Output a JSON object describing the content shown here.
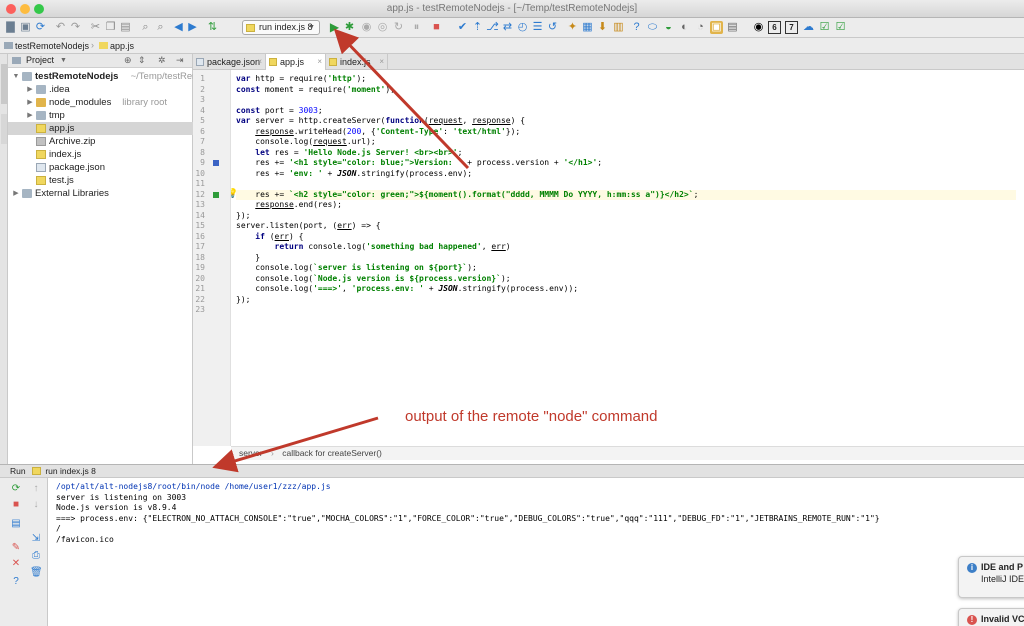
{
  "window": {
    "title": "app.js - testRemoteNodejs - [~/Temp/testRemoteNodejs]"
  },
  "toolbar": {
    "run_config": "run index.js 8",
    "right_badges": [
      "6",
      "7"
    ]
  },
  "breadcrumbs": [
    {
      "label": "testRemoteNodejs"
    },
    {
      "label": "app.js"
    }
  ],
  "project_panel": {
    "title": "Project",
    "tree": [
      {
        "label": "testRemoteNodejs",
        "hint": "~/Temp/testRem",
        "type": "root",
        "indent": 0,
        "expanded": true
      },
      {
        "label": ".idea",
        "hint": "",
        "type": "folder",
        "indent": 1,
        "expanded": false
      },
      {
        "label": "node_modules",
        "hint": "library root",
        "type": "folder-orange",
        "indent": 1,
        "expanded": false
      },
      {
        "label": "tmp",
        "hint": "",
        "type": "folder",
        "indent": 1,
        "expanded": false
      },
      {
        "label": "app.js",
        "hint": "",
        "type": "js",
        "indent": 1,
        "selected": true
      },
      {
        "label": "Archive.zip",
        "hint": "",
        "type": "zip",
        "indent": 1
      },
      {
        "label": "index.js",
        "hint": "",
        "type": "js",
        "indent": 1
      },
      {
        "label": "package.json",
        "hint": "",
        "type": "json",
        "indent": 1
      },
      {
        "label": "test.js",
        "hint": "",
        "type": "js",
        "indent": 1
      },
      {
        "label": "External Libraries",
        "hint": "",
        "type": "lib",
        "indent": 0,
        "expanded": false
      }
    ]
  },
  "editor_tabs": [
    {
      "label": "package.json",
      "active": false
    },
    {
      "label": "app.js",
      "active": true
    },
    {
      "label": "index.js",
      "active": false
    }
  ],
  "code_lines": [
    "var http = require('http');",
    "const moment = require('moment');",
    "",
    "const port = 3003;",
    "var server = http.createServer(function(request, response) {",
    "    response.writeHead(200, {'Content-Type': 'text/html'});",
    "    console.log(request.url);",
    "    let res = 'Hello Node.js Server! <br><br>';",
    "    res += '<h1 style=\"color: blue;\">Version: ' + process.version + '</h1>';",
    "    res += 'env: ' + JSON.stringify(process.env);",
    "",
    "    res += `<h2 style=\"color: green;\">${moment().format(\"dddd, MMMM Do YYYY, h:mm:ss a\")}</h2>`;",
    "    response.end(res);",
    "});",
    "server.listen(port, (err) => {",
    "    if (err) {",
    "        return console.log('something bad happened', err)",
    "    }",
    "    console.log(`server is listening on ${port}`);",
    "    console.log(`Node.js version is ${process.version}`);",
    "    console.log('===>', 'process.env: ' + JSON.stringify(process.env));",
    "});",
    ""
  ],
  "editor_status": {
    "scope": "server",
    "separator": "›",
    "context": "callback for createServer()"
  },
  "run_panel": {
    "label": "Run",
    "config": "run index.js 8"
  },
  "console_lines": [
    "/opt/alt/alt-nodejs8/root/bin/node /home/user1/zzz/app.js",
    "server is listening on 3003",
    "Node.js version is v8.9.4",
    "===> process.env: {\"ELECTRON_NO_ATTACH_CONSOLE\":\"true\",\"MOCHA_COLORS\":\"1\",\"FORCE_COLOR\":\"true\",\"DEBUG_COLORS\":\"true\",\"qqq\":\"111\",\"DEBUG_FD\":\"1\",\"JETBRAINS_REMOTE_RUN\":\"1\"}",
    "/",
    "/favicon.ico"
  ],
  "annotation": {
    "text": "output of the remote \"node\" command"
  },
  "notifications": [
    {
      "title": "IDE and P",
      "body": "IntelliJ IDE",
      "kind": "info",
      "color": "#3d7fc7"
    },
    {
      "title": "Invalid VC",
      "body": "",
      "kind": "error",
      "color": "#d9534f"
    }
  ],
  "colors": {
    "annotation": "#c0392b",
    "run_green": "#2e9c3a",
    "stop_red": "#d9534f"
  }
}
